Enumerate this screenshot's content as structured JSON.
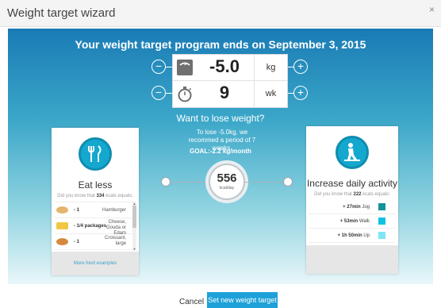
{
  "window": {
    "title": "Weight target wizard",
    "close_glyph": "×"
  },
  "headline": "Your weight target program ends on September 3, 2015",
  "weight": {
    "value": "-5.0",
    "unit": "kg",
    "icon": "scale-icon"
  },
  "duration": {
    "value": "9",
    "unit": "wk",
    "icon": "stopwatch-icon"
  },
  "stepper": {
    "minus": "−",
    "plus": "+"
  },
  "lose": {
    "title": "Want to lose weight?",
    "desc": "To lose -5.0kg, we recommed a period of 7 weeks.",
    "goal": "GOAL:-2.2 kg/month"
  },
  "eat_less": {
    "title": "Eat less",
    "dyk_prefix": "Did you know that",
    "kcal": "334",
    "dyk_suffix": "kcals equals:",
    "foods": [
      {
        "qty": "- 1",
        "name": "Hamburger"
      },
      {
        "qty": "- 1/4 packages",
        "name": "Cheese, Gouda or Edam"
      },
      {
        "qty": "- 1",
        "name": "Croissant, large"
      }
    ],
    "more": "More food examples"
  },
  "activity": {
    "title": "Increase daily activity",
    "dyk_prefix": "Did you know that",
    "kcal": "222",
    "dyk_suffix": "kcals equals:",
    "items": [
      {
        "time": "+ 27min",
        "label": "Jog",
        "color": "#13949b"
      },
      {
        "time": "+ 53min",
        "label": "Walk",
        "color": "#12c2e4"
      },
      {
        "time": "+ 1h 50min",
        "label": "Up",
        "color": "#7fe6f5"
      }
    ]
  },
  "calorie": {
    "value": "556",
    "unit": "kcal/day"
  },
  "colors": {
    "accent": "#1da1d8",
    "hero_top": "#1a7bb5"
  },
  "buttons": {
    "cancel": "Cancel",
    "primary": "Set new weight target"
  }
}
